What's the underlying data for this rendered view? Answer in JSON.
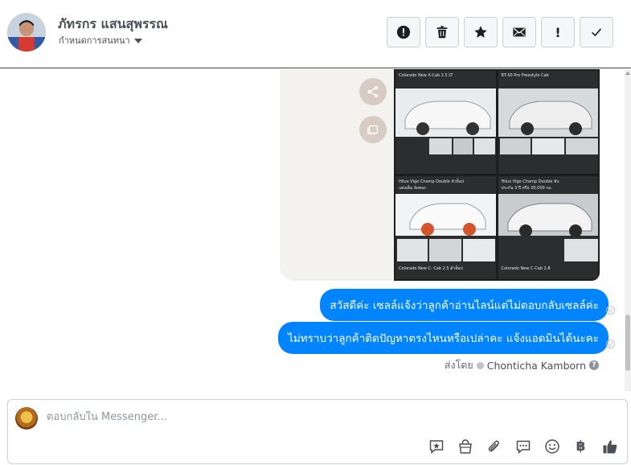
{
  "header": {
    "contact_name": "ภัทรกร แสนสุพรรณ",
    "assign_label": "กำหนดการสนทนา",
    "actions": [
      {
        "name": "report-button",
        "icon": "alert-circle-icon"
      },
      {
        "name": "delete-button",
        "icon": "trash-icon"
      },
      {
        "name": "star-button",
        "icon": "star-icon"
      },
      {
        "name": "mark-unread-button",
        "icon": "envelope-icon"
      },
      {
        "name": "follow-up-button",
        "icon": "exclamation-icon",
        "label": "!"
      },
      {
        "name": "mark-done-button",
        "icon": "check-icon"
      }
    ]
  },
  "image_card": {
    "captions": [
      "Colorado New X-Cab 2.5 LT",
      "BT-50 Pro Freestyle Cab",
      "Hilux Vigo Champ Double ตัวท็อป",
      "Hilux Vigo Champ Double ขับ",
      "ประกัน 3 ปี หรือ 30,000 กม.",
      "แต่งเต็ม ล้อทอง",
      "Colorado New C- Cab 2.5 ตัวท็อป",
      "Colorado New C-Cab 2.8"
    ]
  },
  "messages": [
    {
      "text": "สวัสดีค่ะ เซลล์แจ้งว่าลูกค้าอ่านไลน์แต่ไม่ตอบกลับเซลล์ค่ะ"
    },
    {
      "text": "ไม่ทราบว่าลูกค้าติดปัญหาตรงไหนหรือเปล่าคะ แจ้งแอดมินได้นะคะ"
    }
  ],
  "sent_by": {
    "prefix": "ส่งโดย",
    "agent": "Chonticha Kamborn",
    "help": "?"
  },
  "composer": {
    "placeholder": "ตอบกลับใน Messenger...",
    "baht_symbol": "฿"
  },
  "colors": {
    "bubble": "#0084ff",
    "header_text": "#4b4f56"
  }
}
